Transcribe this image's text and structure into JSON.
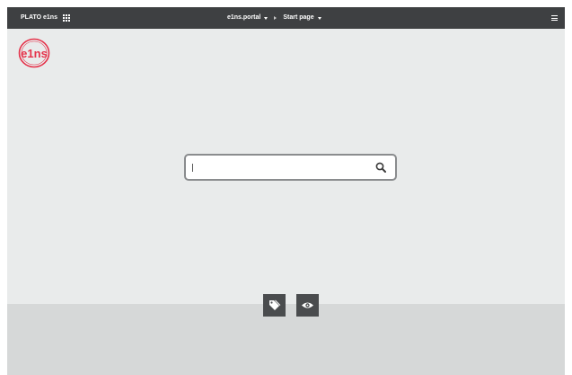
{
  "header": {
    "brand": "PLATO e1ns",
    "portal_label": "e1ns.portal",
    "page_label": "Start page",
    "menu_icon": "hamburger-menu-icon",
    "apps_icon": "apps-grid-icon"
  },
  "logo": {
    "text": "e1ns",
    "color": "#e5334b"
  },
  "search": {
    "value": "",
    "placeholder": "",
    "icon": "search-icon"
  },
  "toolbar": {
    "buttons": [
      {
        "icon": "tags-icon"
      },
      {
        "icon": "eye-icon"
      }
    ]
  },
  "colors": {
    "topbar": "#3e4042",
    "background": "#e9ebeb",
    "footer": "#d6d8d8",
    "accent": "#e5334b"
  }
}
